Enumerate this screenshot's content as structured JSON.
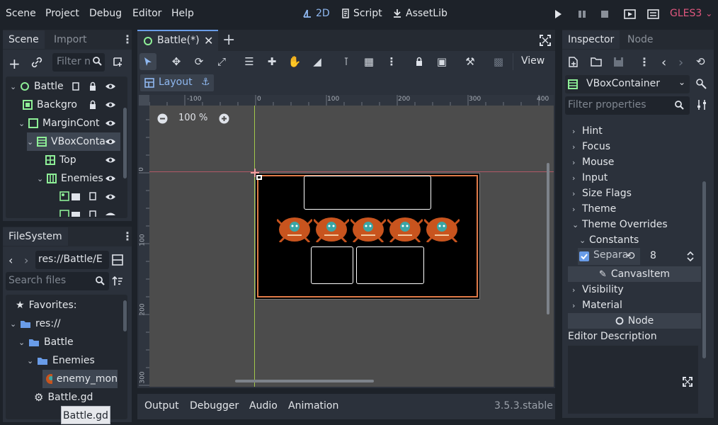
{
  "menu": {
    "scene": "Scene",
    "project": "Project",
    "debug": "Debug",
    "editor": "Editor",
    "help": "Help"
  },
  "workspace": {
    "view2d": "2D",
    "script": "Script",
    "assetlib": "AssetLib"
  },
  "renderer": "GLES3",
  "scene_dock": {
    "tab_scene": "Scene",
    "tab_import": "Import",
    "filter_placeholder": "Filter n",
    "nodes": [
      {
        "label": "Battle"
      },
      {
        "label": "Backgro"
      },
      {
        "label": "MarginCont"
      },
      {
        "label": "VBoxConta"
      },
      {
        "label": "Top"
      },
      {
        "label": "Enemies"
      }
    ]
  },
  "filesystem": {
    "tab": "FileSystem",
    "path": "res://Battle/E",
    "search_placeholder": "Search files",
    "items": [
      {
        "label": "Favorites:"
      },
      {
        "label": "res://"
      },
      {
        "label": "Battle"
      },
      {
        "label": "Enemies"
      },
      {
        "label": "enemy_mon"
      },
      {
        "label": "Battle.gd"
      }
    ],
    "tooltip": "Battle.gd"
  },
  "editor": {
    "scene_tab": "Battle(*)",
    "view_button": "View",
    "layout_label": "Layout",
    "zoom": "100 %",
    "ruler_h": [
      "-100",
      "0",
      "100",
      "200",
      "300",
      "400"
    ],
    "ruler_v": [
      "0",
      "100",
      "200",
      "300"
    ]
  },
  "bottom": {
    "output": "Output",
    "debugger": "Debugger",
    "audio": "Audio",
    "animation": "Animation",
    "version": "3.5.3.stable"
  },
  "inspector": {
    "tab_inspector": "Inspector",
    "tab_node": "Node",
    "node_type": "VBoxContainer",
    "filter_placeholder": "Filter properties",
    "sections": [
      "Hint",
      "Focus",
      "Mouse",
      "Input",
      "Size Flags",
      "Theme",
      "Theme Overrides"
    ],
    "constants": "Constants",
    "separation_label": "Separa",
    "separation_value": "8",
    "canvas_item": "CanvasItem",
    "visibility": "Visibility",
    "material": "Material",
    "node": "Node",
    "editor_description": "Editor Description"
  },
  "colors": {
    "accent": "#699ce8",
    "panel": "#2b313b",
    "bg": "#1d2229",
    "selection": "#3e4652",
    "renderer": "#e0577e"
  }
}
